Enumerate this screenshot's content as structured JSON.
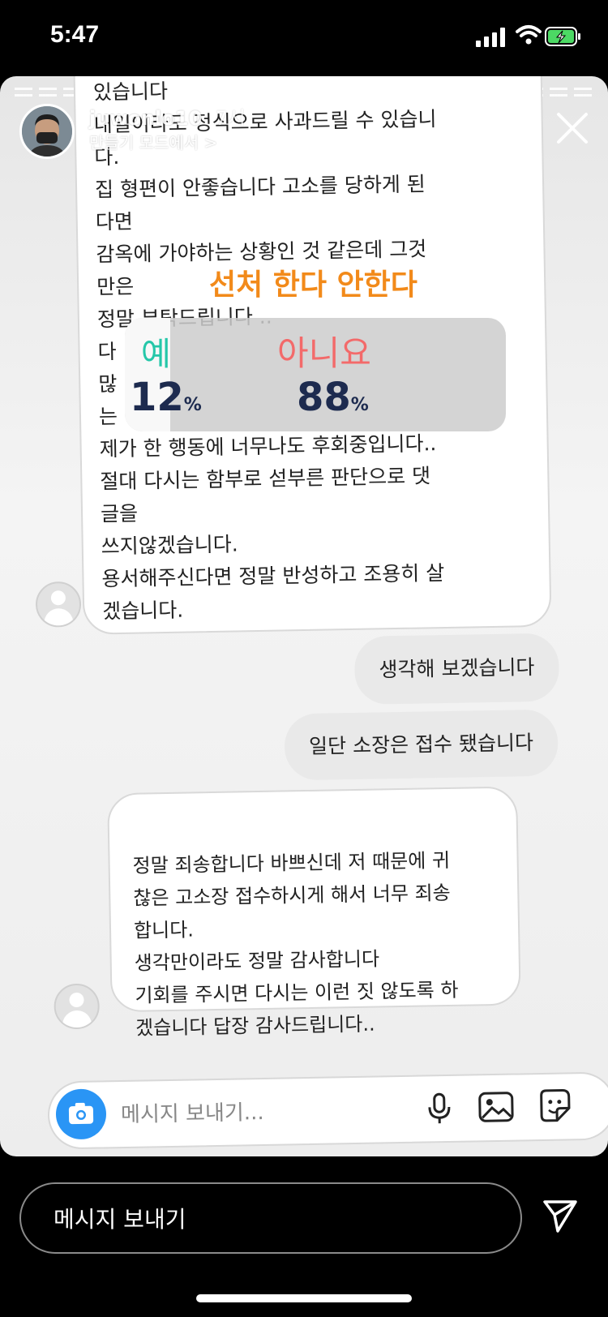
{
  "status": {
    "time": "5:47"
  },
  "story": {
    "username": "juwonlo10",
    "age": "7시",
    "subtitle": "만들기 모드에서 >",
    "poll": {
      "question": "선처 한다 안한다",
      "yes_label": "예",
      "no_label": "아니요",
      "yes_percent": 12,
      "no_percent": 88,
      "yes_text": "12",
      "no_text": "88",
      "percent_sign": "%"
    }
  },
  "chat": {
    "long_message_lines": [
      "있습니다",
      "내일이라도 정식으로 사과드릴 수 있습니",
      "다.",
      "집 형편이 안좋습니다 고소를 당하게 된",
      "다면",
      "감옥에 가야하는 상황인 것 같은데 그것",
      "만은",
      "정말 부탁드립니다 ..",
      "다",
      "많",
      "는",
      "제가 한 행동에 너무나도 후회중입니다..",
      "절대 다시는 함부로 섣부른 판단으로 댓",
      "글을",
      "쓰지않겠습니다.",
      "용서해주신다면 정말 반성하고 조용히 살",
      "겠습니다."
    ],
    "reply_1": "생각해 보겠습니다",
    "reply_2": "일단 소장은 접수 됐습니다",
    "last_message": "정말 죄송합니다 바쁘신데 저 때문에 귀\n찮은 고소장 접수하시게 해서 너무 죄송\n합니다.\n생각만이라도 정말 감사합니다\n기회를 주시면 다시는 이런 짓 않도록 하\n겠습니다 답장 감사드립니다..",
    "composer_placeholder": "메시지 보내기..."
  },
  "reply_bar": {
    "placeholder": "메시지 보내기"
  },
  "colors": {
    "poll_title": "#f28a1a",
    "poll_yes": "#25c7a9",
    "poll_no": "#f36a6a",
    "camera_button": "#2a95f5"
  },
  "icons": [
    "signal-icon",
    "wifi-icon",
    "battery-icon",
    "more-icon",
    "close-icon",
    "camera-icon",
    "mic-icon",
    "image-icon",
    "sticker-icon",
    "send-icon"
  ]
}
